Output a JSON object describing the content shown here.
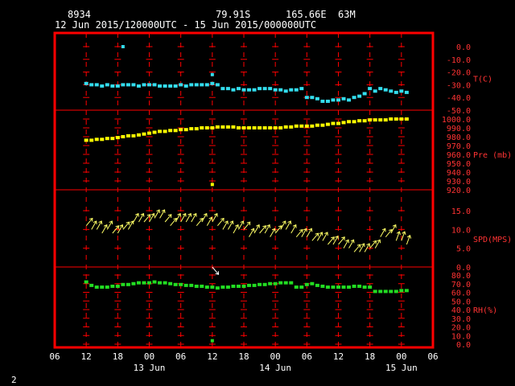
{
  "header": {
    "station_id": "8934",
    "lat": "79.91S",
    "lon": "165.66E",
    "elev": "63M",
    "time_range": "12 Jun 2015/120000UTC - 15 Jun 2015/000000UTC"
  },
  "corner_label": "2",
  "colors": {
    "frame": "#ff0000",
    "grid": "#ff0000",
    "temp": "#33ddee",
    "pres": "#ffff00",
    "wind": "#ffff66",
    "wind_alt": "#ffffff",
    "rh": "#22dd22",
    "labels": "#ff3333",
    "xlabels": "#ffffff"
  },
  "chart_data": {
    "type": "scatter",
    "x_unit": "hours since 12 Jun 2015 00 UTC",
    "xlim": [
      6,
      78
    ],
    "x_ticks": [
      {
        "h": 6,
        "label": "06"
      },
      {
        "h": 12,
        "label": "12"
      },
      {
        "h": 18,
        "label": "18"
      },
      {
        "h": 24,
        "label": "00"
      },
      {
        "h": 30,
        "label": "06"
      },
      {
        "h": 36,
        "label": "12"
      },
      {
        "h": 42,
        "label": "18"
      },
      {
        "h": 48,
        "label": "00"
      },
      {
        "h": 54,
        "label": "06"
      },
      {
        "h": 60,
        "label": "12"
      },
      {
        "h": 66,
        "label": "18"
      },
      {
        "h": 72,
        "label": "00"
      },
      {
        "h": 78,
        "label": "06"
      }
    ],
    "date_labels": [
      {
        "h": 24,
        "label": "13 Jun"
      },
      {
        "h": 48,
        "label": "14 Jun"
      },
      {
        "h": 72,
        "label": "15 Jun"
      }
    ],
    "panels": [
      {
        "name": "temp",
        "label": "T(C)",
        "ylim": [
          -50,
          0
        ],
        "kind": "points",
        "ticks": [
          "0.0",
          "-10.0",
          "-20.0",
          "-30.0",
          "-40.0",
          "-50.0"
        ],
        "tick_values": [
          0,
          -10,
          -20,
          -30,
          -40,
          -50
        ],
        "x": [
          12,
          13,
          14,
          15,
          16,
          17,
          18,
          19,
          20,
          21,
          22,
          23,
          24,
          25,
          26,
          27,
          28,
          29,
          30,
          31,
          32,
          33,
          34,
          35,
          36,
          37,
          38,
          39,
          40,
          41,
          42,
          43,
          44,
          45,
          46,
          47,
          48,
          49,
          50,
          51,
          52,
          53,
          54,
          55,
          56,
          57,
          58,
          59,
          60,
          61,
          62,
          63,
          64,
          65,
          66,
          67,
          68,
          69,
          70,
          71,
          72,
          73
        ],
        "y": [
          -29,
          -30,
          -30,
          -31,
          -30,
          -31,
          -31,
          -30,
          -30,
          -30,
          -31,
          -30,
          -30,
          -30,
          -31,
          -31,
          -31,
          -31,
          -30,
          -31,
          -30,
          -30,
          -30,
          -30,
          -29,
          -30,
          -33,
          -33,
          -34,
          -33,
          -34,
          -34,
          -34,
          -33,
          -33,
          -33,
          -34,
          -34,
          -35,
          -34,
          -34,
          -33,
          -40,
          -40,
          -41,
          -43,
          -43,
          -42,
          -42,
          -41,
          -42,
          -40,
          -39,
          -37,
          -33,
          -35,
          -33,
          -34,
          -35,
          -36,
          -35,
          -36
        ],
        "outliers": [
          {
            "x": 19,
            "y": 0
          },
          {
            "x": 36,
            "y": -22
          }
        ]
      },
      {
        "name": "pres",
        "label": "Pre (mb)",
        "ylim": [
          920,
          1000
        ],
        "kind": "points",
        "ticks": [
          "1000.0",
          "990.0",
          "980.0",
          "970.0",
          "960.0",
          "950.0",
          "940.0",
          "930.0",
          "920.0"
        ],
        "tick_values": [
          1000,
          990,
          980,
          970,
          960,
          950,
          940,
          930,
          920
        ],
        "x": [
          12,
          13,
          14,
          15,
          16,
          17,
          18,
          19,
          20,
          21,
          22,
          23,
          24,
          25,
          26,
          27,
          28,
          29,
          30,
          31,
          32,
          33,
          34,
          35,
          36,
          37,
          38,
          39,
          40,
          41,
          42,
          43,
          44,
          45,
          46,
          47,
          48,
          49,
          50,
          51,
          52,
          53,
          54,
          55,
          56,
          57,
          58,
          59,
          60,
          61,
          62,
          63,
          64,
          65,
          66,
          67,
          68,
          69,
          70,
          71,
          72,
          73
        ],
        "y": [
          976,
          976,
          977,
          977,
          978,
          978,
          979,
          980,
          981,
          981,
          982,
          983,
          984,
          985,
          986,
          986,
          987,
          987,
          988,
          988,
          989,
          989,
          990,
          990,
          990,
          991,
          991,
          991,
          991,
          990,
          990,
          990,
          990,
          990,
          990,
          990,
          990,
          990,
          991,
          991,
          992,
          992,
          992,
          992,
          993,
          993,
          994,
          995,
          995,
          996,
          997,
          997,
          998,
          998,
          999,
          999,
          999,
          999,
          1000,
          1000,
          1000,
          1000
        ],
        "outliers": [
          {
            "x": 36,
            "y": 926
          }
        ]
      },
      {
        "name": "spd",
        "label": "SPD(MPS)",
        "ylim": [
          0,
          15
        ],
        "kind": "wind",
        "ticks": [
          "15.0",
          "10.0",
          "5.0",
          "0.0"
        ],
        "tick_values": [
          15,
          10,
          5,
          0
        ],
        "x": [
          12,
          13,
          14,
          15,
          16,
          17,
          18,
          19,
          20,
          21,
          22,
          23,
          24,
          25,
          26,
          27,
          28,
          29,
          30,
          31,
          32,
          33,
          34,
          35,
          36,
          37,
          38,
          39,
          40,
          41,
          42,
          43,
          44,
          45,
          46,
          47,
          48,
          49,
          50,
          51,
          52,
          53,
          54,
          55,
          56,
          57,
          58,
          59,
          60,
          61,
          62,
          63,
          64,
          65,
          66,
          67,
          68,
          69,
          70,
          71,
          72,
          73
        ],
        "y": [
          11,
          10,
          10,
          9,
          10,
          9,
          9,
          10,
          10,
          12,
          12,
          12,
          12,
          13,
          13,
          12,
          11,
          12,
          12,
          12,
          12,
          11,
          12,
          11,
          12,
          11,
          10,
          10,
          9,
          10,
          10,
          8,
          9,
          9,
          9,
          8,
          9,
          10,
          10,
          9,
          8,
          8,
          8,
          7,
          7,
          7,
          6,
          6,
          6,
          5,
          5,
          4,
          4,
          4,
          5,
          5,
          8,
          8,
          9,
          7,
          7,
          6
        ],
        "dir": [
          40,
          30,
          30,
          30,
          30,
          40,
          30,
          40,
          30,
          30,
          30,
          40,
          30,
          30,
          30,
          40,
          40,
          30,
          30,
          30,
          30,
          40,
          30,
          30,
          30,
          40,
          30,
          30,
          30,
          30,
          40,
          30,
          30,
          40,
          30,
          30,
          40,
          30,
          30,
          30,
          40,
          30,
          30,
          40,
          30,
          30,
          40,
          30,
          40,
          30,
          30,
          40,
          30,
          30,
          40,
          30,
          30,
          40,
          30,
          20,
          20,
          20
        ],
        "outliers": [
          {
            "x": 36,
            "y": 0,
            "dir": 140
          }
        ]
      },
      {
        "name": "rh",
        "label": "RH(%)",
        "ylim": [
          0,
          80
        ],
        "kind": "points",
        "ticks": [
          "80.0",
          "70.0",
          "60.0",
          "50.0",
          "40.0",
          "30.0",
          "20.0",
          "10.0",
          "0.0"
        ],
        "tick_values": [
          80,
          70,
          60,
          50,
          40,
          30,
          20,
          10,
          0
        ],
        "x": [
          12,
          13,
          14,
          15,
          16,
          17,
          18,
          19,
          20,
          21,
          22,
          23,
          24,
          25,
          26,
          27,
          28,
          29,
          30,
          31,
          32,
          33,
          34,
          35,
          36,
          37,
          38,
          39,
          40,
          41,
          42,
          43,
          44,
          45,
          46,
          47,
          48,
          49,
          50,
          51,
          52,
          53,
          54,
          55,
          56,
          57,
          58,
          59,
          60,
          61,
          62,
          63,
          64,
          65,
          66,
          67,
          68,
          69,
          70,
          71,
          72,
          73
        ],
        "y": [
          72,
          68,
          66,
          66,
          66,
          67,
          67,
          69,
          69,
          70,
          71,
          71,
          71,
          72,
          71,
          71,
          70,
          69,
          69,
          68,
          68,
          67,
          67,
          66,
          66,
          65,
          66,
          66,
          67,
          67,
          67,
          68,
          68,
          69,
          69,
          70,
          70,
          71,
          71,
          71,
          66,
          66,
          69,
          70,
          68,
          67,
          66,
          66,
          66,
          66,
          66,
          67,
          67,
          66,
          66,
          61,
          61,
          61,
          61,
          61,
          62,
          62
        ],
        "outliers": [
          {
            "x": 36,
            "y": 4
          }
        ]
      }
    ]
  }
}
